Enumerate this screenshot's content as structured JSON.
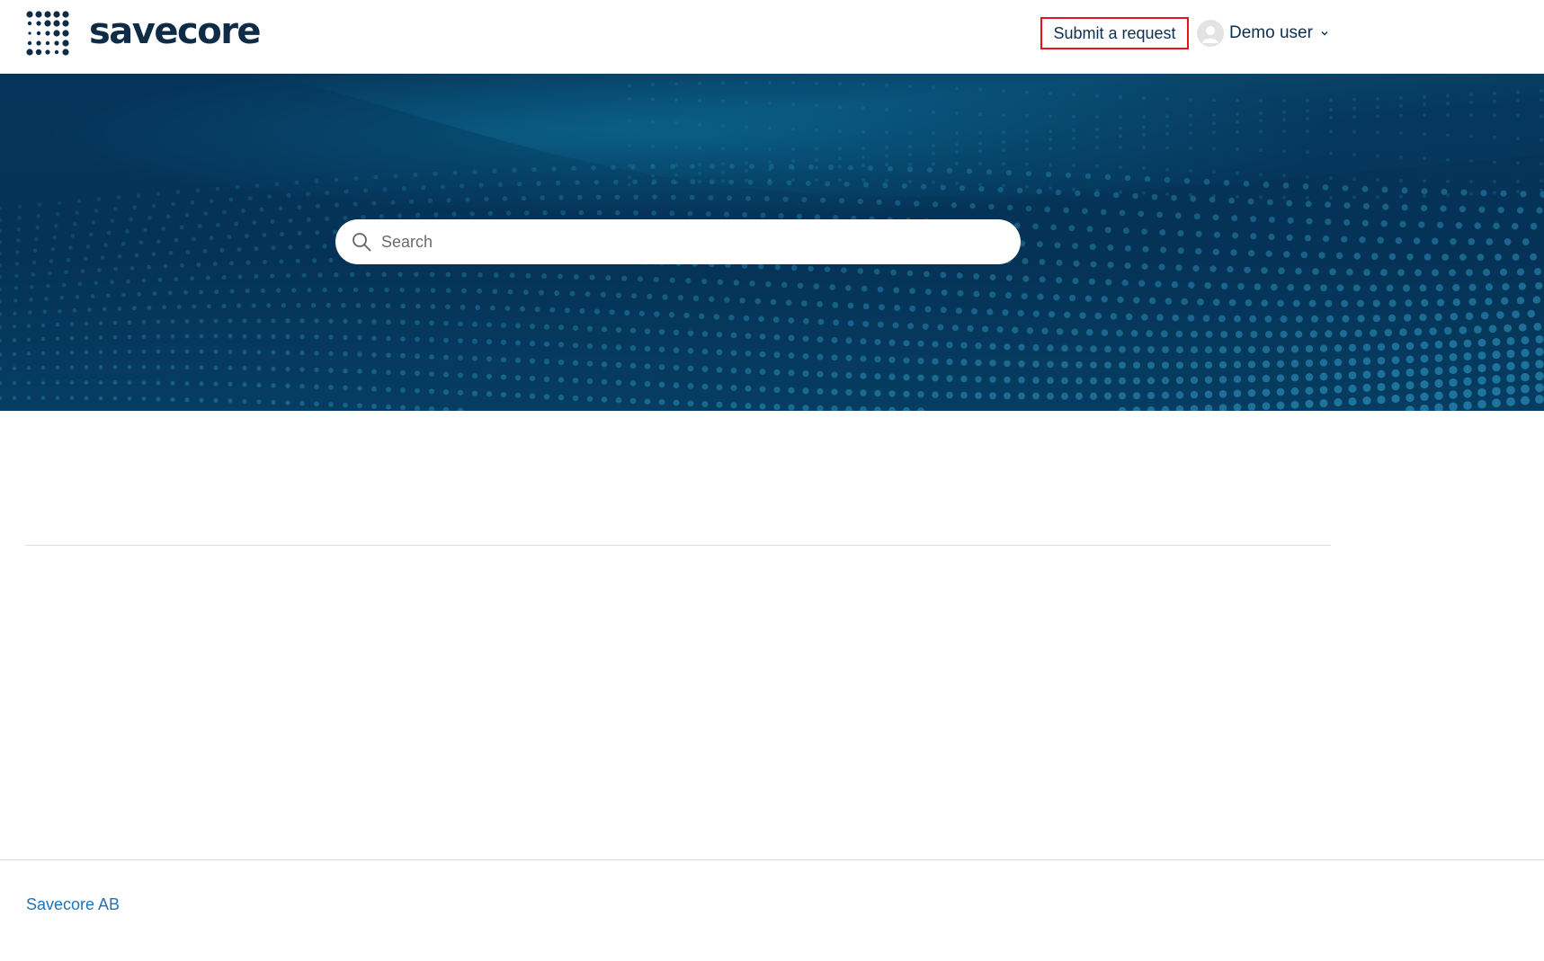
{
  "header": {
    "brand_name": "savecore",
    "submit_request_label": "Submit a request",
    "user": {
      "name": "Demo user"
    }
  },
  "hero": {
    "search": {
      "placeholder": "Search",
      "value": ""
    }
  },
  "footer": {
    "company_link": "Savecore AB"
  },
  "colors": {
    "brand_navy": "#0e2c47",
    "hero_dark": "#053357",
    "hero_accent": "#0a6e96",
    "highlight_border": "#e3141e",
    "footer_link": "#1f73b7"
  },
  "icons": {
    "logo": "dot-grid-logo-icon",
    "avatar": "user-avatar-icon",
    "chevron": "chevron-down-icon",
    "search": "search-icon"
  }
}
